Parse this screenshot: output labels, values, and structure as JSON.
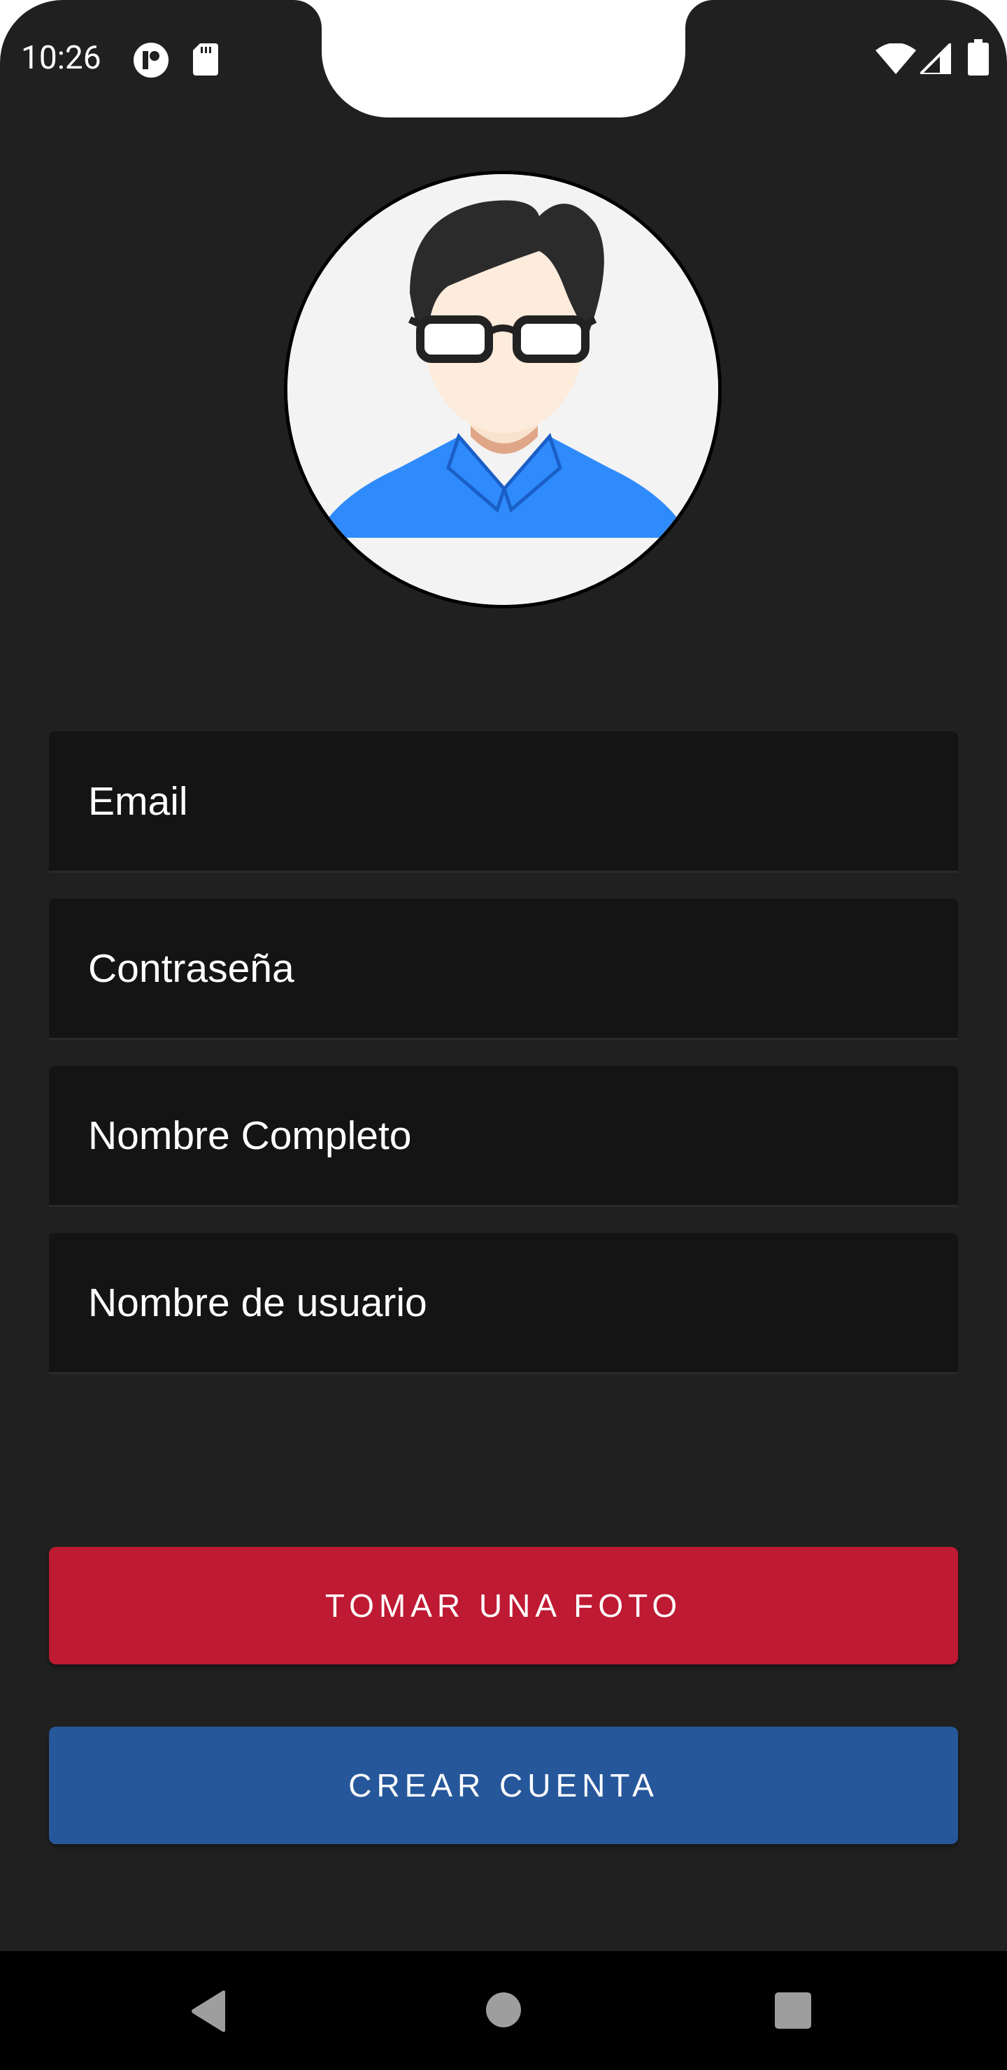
{
  "status_bar": {
    "time": "10:26",
    "icons": [
      "app-notification-icon",
      "sd-card-icon",
      "wifi-icon",
      "cell-signal-icon",
      "battery-icon"
    ]
  },
  "profile": {
    "avatar_icon": "user-avatar-placeholder"
  },
  "form": {
    "email_placeholder": "Email",
    "password_placeholder": "Contraseña",
    "full_name_placeholder": "Nombre Completo",
    "username_placeholder": "Nombre de usuario"
  },
  "actions": {
    "take_photo_label": "TOMAR UNA FOTO",
    "create_account_label": "CREAR CUENTA"
  },
  "navigation": {
    "icons": [
      "back-icon",
      "home-icon",
      "recents-icon"
    ]
  },
  "colors": {
    "background": "#202020",
    "field_background": "#141414",
    "take_photo_button": "#bf1a33",
    "create_account_button": "#27579b",
    "shirt_blue": "#2f8bfb"
  }
}
